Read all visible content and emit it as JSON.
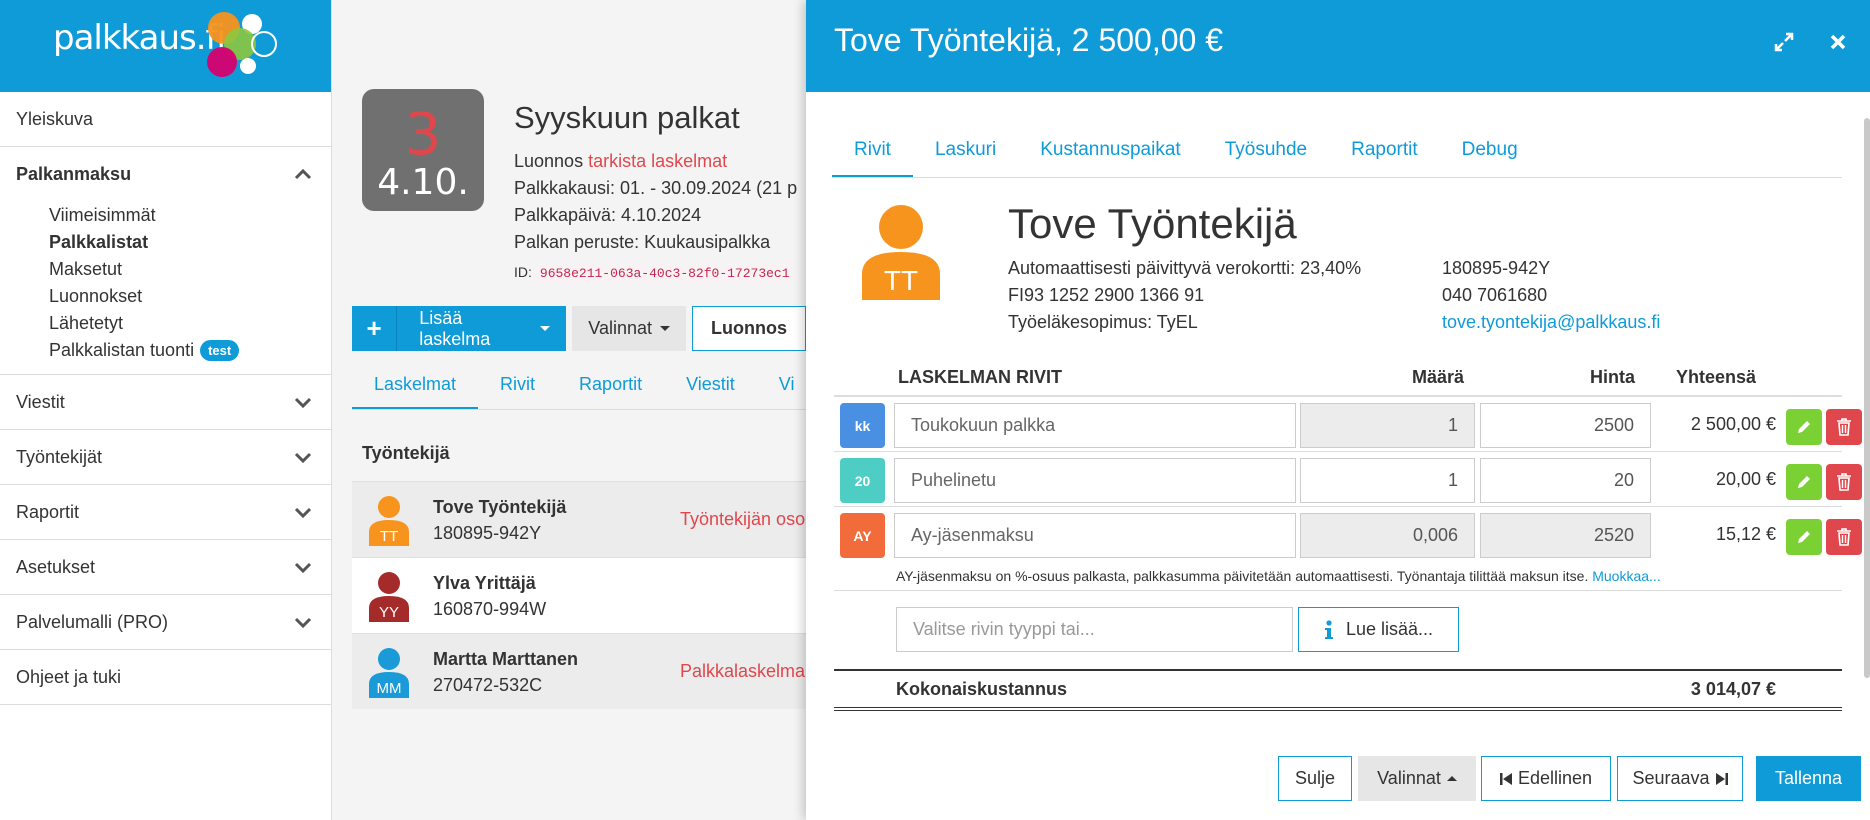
{
  "sidebar": {
    "logo": "palkkaus.fi",
    "overview": "Yleiskuva",
    "payroll": {
      "label": "Palkanmaksu",
      "sub_items": [
        "Viimeisimmät",
        "Palkkalistat",
        "Maksetut",
        "Luonnokset",
        "Lähetetyt",
        "Palkkalistan tuonti"
      ],
      "badge": "test"
    },
    "items": [
      "Viestit",
      "Työntekijät",
      "Raportit",
      "Asetukset",
      "Palvelumalli (PRO)"
    ],
    "help": "Ohjeet ja tuki"
  },
  "run": {
    "date_number": "3",
    "date_text": "4.10.",
    "title": "Syyskuun palkat",
    "status_prefix": "Luonnos",
    "status_link": "tarkista laskelmat",
    "period": "Palkkakausi: 01. - 30.09.2024 (21 p",
    "pay_date": "Palkkapäivä: 4.10.2024",
    "basis": "Palkan peruste: Kuukausipalkka",
    "id_label": "ID:",
    "id_value": "9658e211-063a-40c3-82f0-17273ec1"
  },
  "toolbar": {
    "plus": "+",
    "add_label": "Lisää laskelma",
    "options_label": "Valinnat",
    "draft_label": "Luonnos"
  },
  "middle_tabs": [
    "Laskelmat",
    "Rivit",
    "Raportit",
    "Viestit",
    "Vi"
  ],
  "employees": {
    "header": "Työntekijä",
    "rows": [
      {
        "initials": "TT",
        "name": "Tove Työntekijä",
        "id": "180895-942Y",
        "note": "Työntekijän osoit",
        "color": "#f7941d"
      },
      {
        "initials": "YY",
        "name": "Ylva Yrittäjä",
        "id": "160870-994W",
        "note": "",
        "color": "#a52a2a"
      },
      {
        "initials": "MM",
        "name": "Martta Marttanen",
        "id": "270472-532C",
        "note": "Palkkalaskelman",
        "color": "#1a9ad6"
      }
    ]
  },
  "modal": {
    "title": "Tove Työntekijä, 2 500,00 €",
    "tabs": [
      "Rivit",
      "Laskuri",
      "Kustannuspaikat",
      "Työsuhde",
      "Raportit",
      "Debug"
    ],
    "employee": {
      "initials": "TT",
      "name": "Tove Työntekijä",
      "tax_card": "Automaattisesti päivittyvä verokortti: 23,40%",
      "iban": "FI93 1252 2900 1366 91",
      "pension": "Työeläkesopimus: TyEL",
      "ssn": "180895-942Y",
      "phone": "040 7061680",
      "email": "tove.tyontekija@palkkaus.fi"
    },
    "table": {
      "col_rows": "LASKELMAN RIVIT",
      "col_qty": "Määrä",
      "col_price": "Hinta",
      "col_total": "Yhteensä",
      "rows": [
        {
          "badge": "kk",
          "badge_color": "#4a90e2",
          "name": "Toukokuun palkka",
          "qty": "1",
          "price": "2500",
          "total": "2 500,00 €"
        },
        {
          "badge": "20",
          "badge_color": "#4ecdc4",
          "name": "Puhelinetu",
          "qty": "1",
          "price": "20",
          "total": "20,00 €"
        },
        {
          "badge": "AY",
          "badge_color": "#f26b3a",
          "name": "Ay-jäsenmaksu",
          "qty": "0,006",
          "price": "2520",
          "total": "15,12 €"
        }
      ],
      "ay_note": "AY-jäsenmaksu on %-osuus palkasta, palkkasumma päivitetään automaattisesti. Työnantaja tilittää maksun itse.",
      "ay_note_link": "Muokkaa...",
      "row_type_placeholder": "Valitse rivin tyyppi tai...",
      "read_more": "Lue lisää...",
      "total_label": "Kokonaiskustannus",
      "total_value": "3 014,07 €"
    },
    "footer": {
      "close": "Sulje",
      "options": "Valinnat",
      "previous": "Edellinen",
      "next": "Seuraava",
      "save": "Tallenna"
    }
  },
  "colors": {
    "brand": "#0f9bd8",
    "danger": "#e0474c",
    "success": "#7bd133"
  }
}
